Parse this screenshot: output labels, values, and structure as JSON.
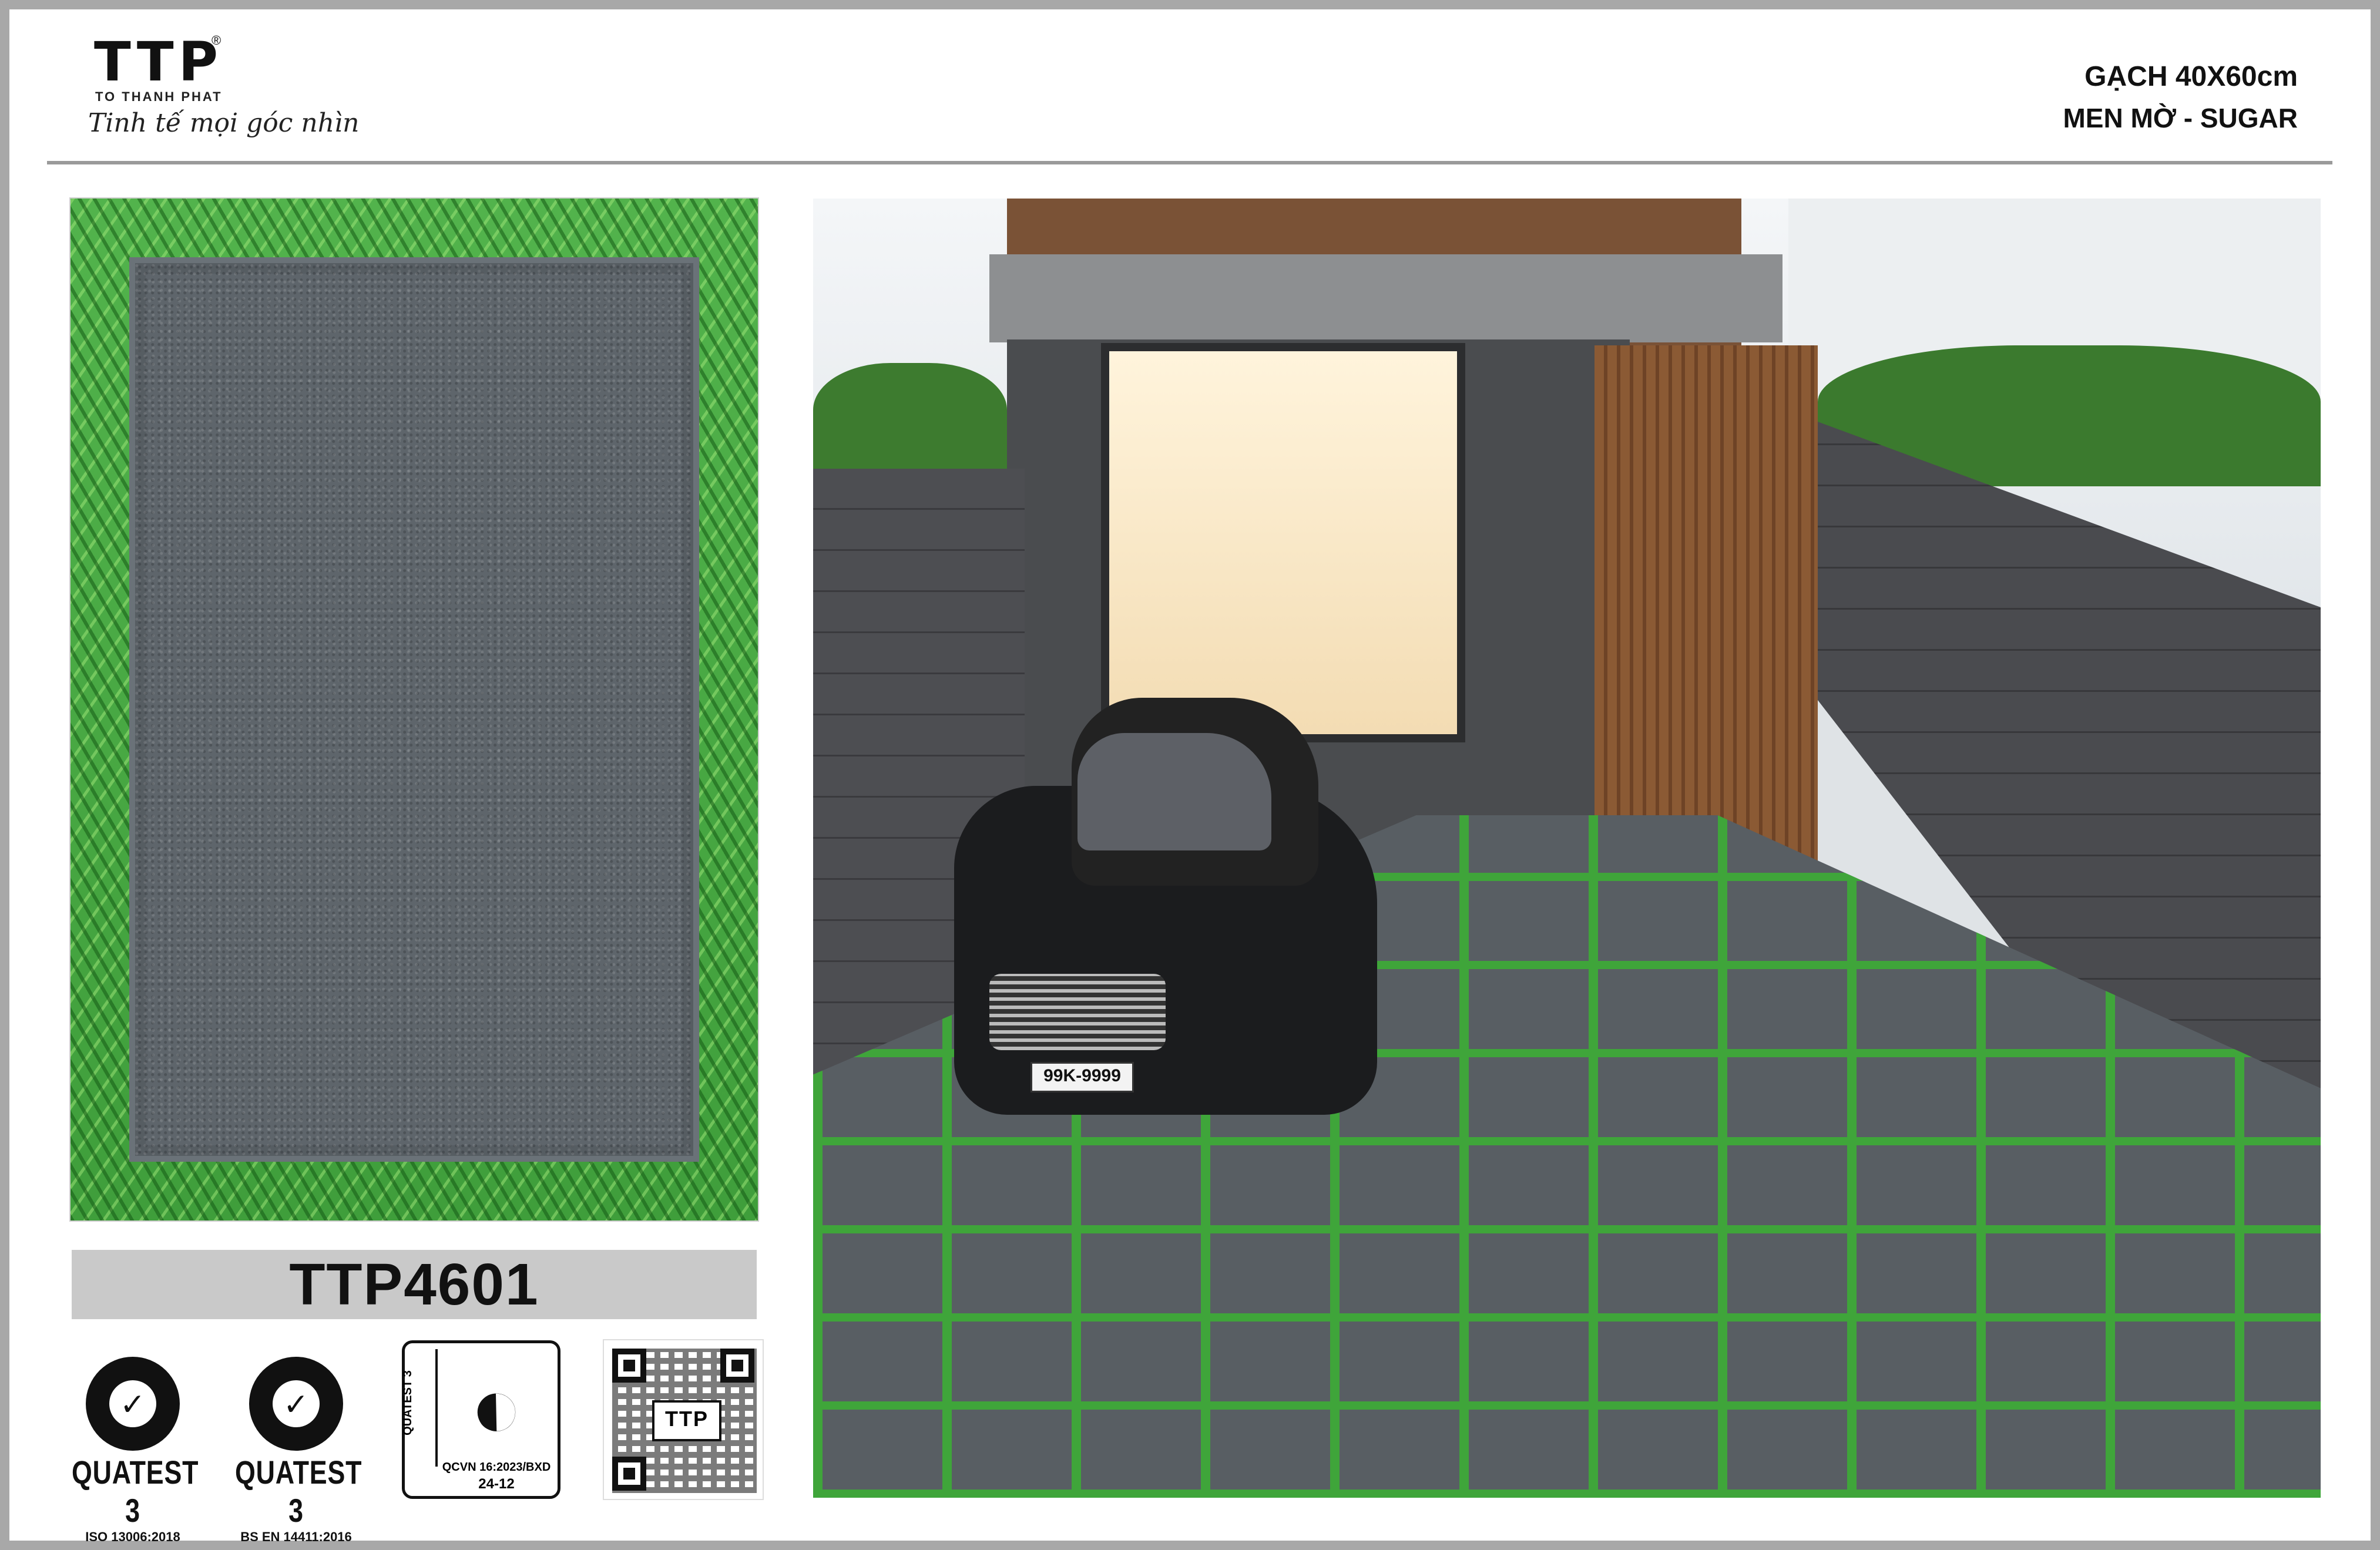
{
  "brand": {
    "mark": "TTP",
    "registered": "®",
    "company": "TO THANH PHAT",
    "tagline": "Tinh tế mọi góc nhìn"
  },
  "spec": {
    "size_line": "GẠCH 40X60cm",
    "finish_line": "MEN MỜ - SUGAR"
  },
  "product": {
    "code": "TTP4601"
  },
  "certifications": [
    {
      "name": "QUATEST 3",
      "standard": "ISO 13006:2018"
    },
    {
      "name": "QUATEST 3",
      "standard": "BS EN 14411:2016"
    }
  ],
  "cr_mark": {
    "side_label": "QUATEST 3",
    "regulation": "QCVN 16:2023/BXD",
    "code": "24-12"
  },
  "qr": {
    "badge": "TTP"
  },
  "photo": {
    "plate": "99K-9999"
  },
  "colors": {
    "border": "#a8a8a8",
    "tile_stone": "#5e656b",
    "grass": "#4cb84a",
    "code_bar": "#c9c9c9"
  }
}
